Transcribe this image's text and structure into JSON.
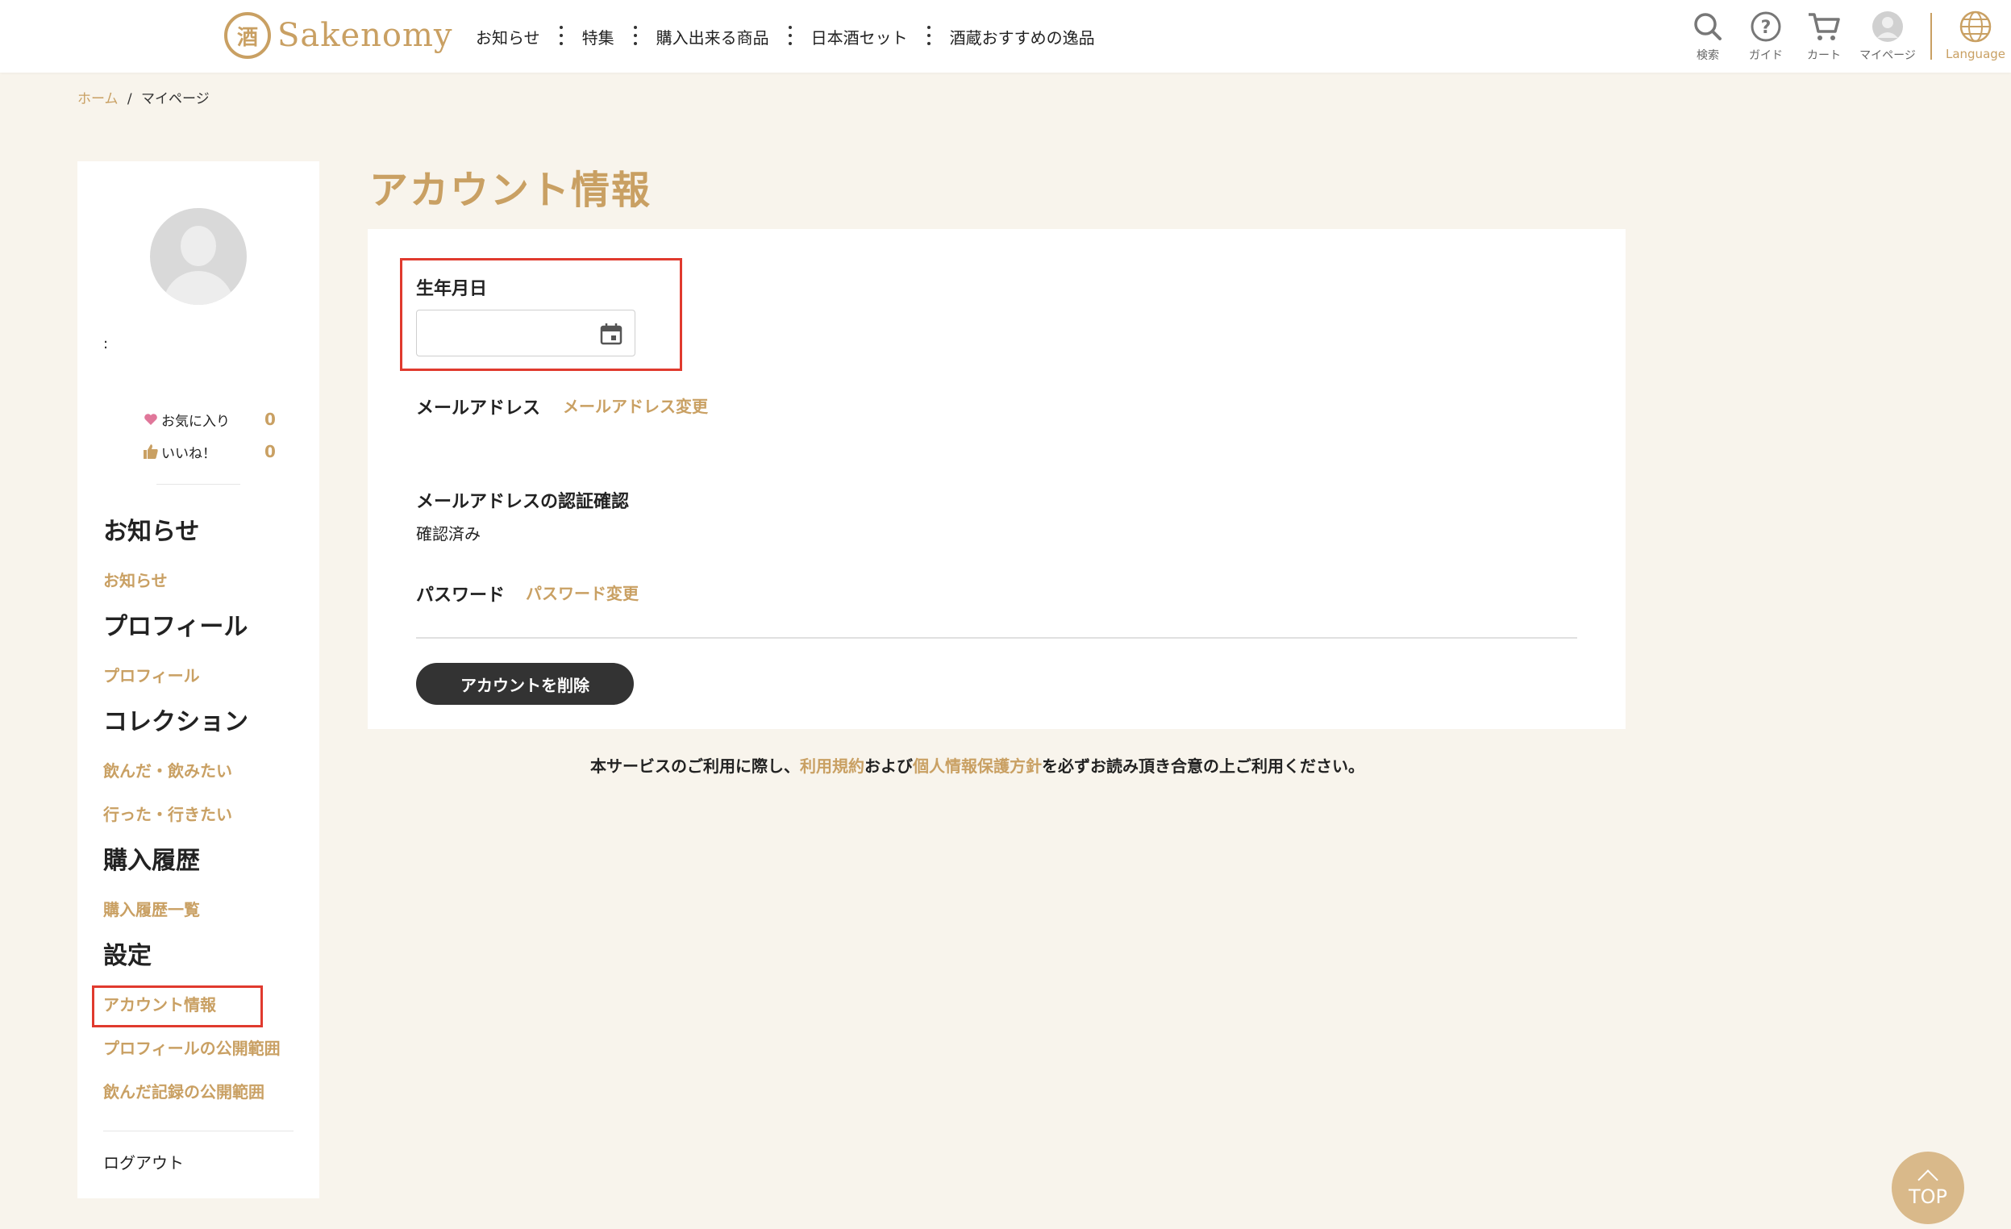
{
  "header": {
    "logo_text": "Sakenomy",
    "logo_mark": "酒",
    "nav": [
      "お知らせ",
      "特集",
      "購入出来る商品",
      "日本酒セット",
      "酒蔵おすすめの逸品"
    ],
    "icons": [
      {
        "name": "search-icon",
        "label": "検索"
      },
      {
        "name": "guide-icon",
        "label": "ガイド"
      },
      {
        "name": "cart-icon",
        "label": "カート"
      },
      {
        "name": "mypage-avatar-icon",
        "label": "マイページ"
      }
    ],
    "language_label": "Language"
  },
  "breadcrumb": {
    "home": "ホーム",
    "sep": "/",
    "current": "マイページ"
  },
  "sidebar": {
    "colon": ":",
    "favorites_label": "お気に入り",
    "favorites_count": "0",
    "likes_label": "いいね！",
    "likes_count": "0",
    "sections": {
      "news_title": "お知らせ",
      "news_link": "お知らせ",
      "profile_title": "プロフィール",
      "profile_link": "プロフィール",
      "collection_title": "コレクション",
      "collection_link1": "飲んだ・飲みたい",
      "collection_link2": "行った・行きたい",
      "purchase_title": "購入履歴",
      "purchase_link": "購入履歴一覧",
      "settings_title": "設定",
      "settings_link1": "アカウント情報",
      "settings_link2": "プロフィールの公開範囲",
      "settings_link3": "飲んだ記録の公開範囲"
    },
    "logout": "ログアウト"
  },
  "main": {
    "title": "アカウント情報",
    "dob_label": "生年月日",
    "dob_value": "",
    "email_label": "メールアドレス",
    "email_change": "メールアドレス変更",
    "email_verify_label": "メールアドレスの認証確認",
    "email_verify_value": "確認済み",
    "password_label": "パスワード",
    "password_change": "パスワード変更",
    "delete_button": "アカウントを削除"
  },
  "notice": {
    "pre": "本サービスのご利用に際し、",
    "terms": "利用規約",
    "mid": "および",
    "privacy": "個人情報保護方針",
    "post": "を必ずお読み頂き合意の上ご利用ください。"
  },
  "top_button": "TOP",
  "colors": {
    "accent": "#c9a063",
    "highlight": "#e03a2e",
    "dark_button": "#333333"
  }
}
